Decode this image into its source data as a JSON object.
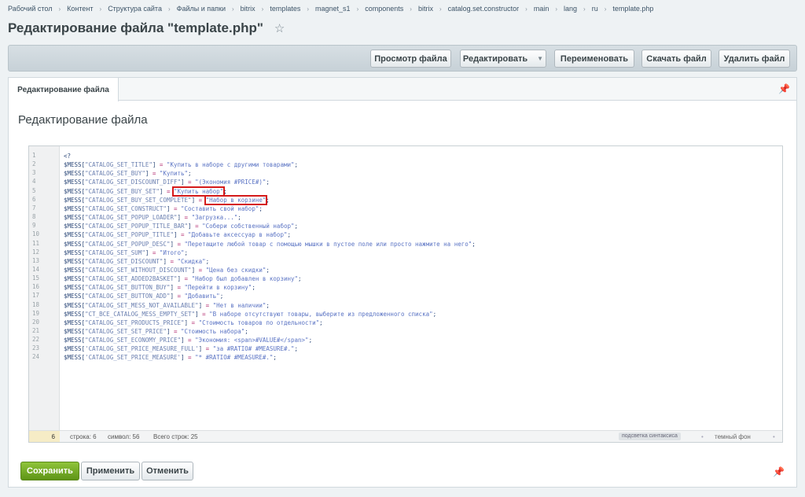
{
  "breadcrumbs": [
    "Рабочий стол",
    "Контент",
    "Структура сайта",
    "Файлы и папки",
    "bitrix",
    "templates",
    "magnet_s1",
    "components",
    "bitrix",
    "catalog.set.constructor",
    "main",
    "lang",
    "ru",
    "template.php"
  ],
  "page": {
    "title": "Редактирование файла \"template.php\"",
    "star_icon": "☆"
  },
  "toolbar": {
    "view_label": "Просмотр файла",
    "edit_label": "Редактировать",
    "rename_label": "Переименовать",
    "download_label": "Скачать файл",
    "delete_label": "Удалить файл"
  },
  "tabs": [
    {
      "label": "Редактирование файла"
    }
  ],
  "section_title": "Редактирование файла",
  "code_lines": [
    "<?",
    "$MESS[\"CATALOG_SET_TITLE\"] = \"Купить в наборе с другими товарами\";",
    "$MESS[\"CATALOG_SET_BUY\"] = \"Купить\";",
    "$MESS[\"CATALOG_SET_DISCOUNT_DIFF\"] = \"(Экономия #PRICE#)\";",
    "$MESS[\"CATALOG_SET_BUY_SET\"] = \"Купить набор\";",
    "$MESS[\"CATALOG_SET_BUY_SET_COMPLETE\"] = \"Набор в корзине\";",
    "$MESS[\"CATALOG_SET_CONSTRUCT\"] = \"Составить свой набор\";",
    "$MESS[\"CATALOG_SET_POPUP_LOADER\"] = \"Загрузка...\";",
    "$MESS[\"CATALOG_SET_POPUP_TITLE_BAR\"] = \"Собери собственный набор\";",
    "$MESS[\"CATALOG_SET_POPUP_TITLE\"] = \"Добавьте аксессуар в набор\";",
    "$MESS[\"CATALOG_SET_POPUP_DESC\"] = \"Перетащите любой товар с помощью мышки в пустое поле или просто нажмите на него\";",
    "$MESS[\"CATALOG_SET_SUM\"] = \"Итого\";",
    "$MESS[\"CATALOG_SET_DISCOUNT\"] = \"Скидка\";",
    "$MESS[\"CATALOG_SET_WITHOUT_DISCOUNT\"] = \"Цена без скидки\";",
    "$MESS[\"CATALOG_SET_ADDED2BASKET\"] = \"Набор был добавлен в корзину\";",
    "$MESS[\"CATALOG_SET_BUTTON_BUY\"] = \"Перейти в корзину\";",
    "$MESS[\"CATALOG_SET_BUTTON_ADD\"] = \"Добавить\";",
    "$MESS[\"CATALOG_SET_MESS_NOT_AVAILABLE\"] = \"Нет в наличии\";",
    "$MESS[\"CT_BCE_CATALOG_MESS_EMPTY_SET\"] = \"В наборе отсутствуют товары, выберите из предложенного списка\";",
    "$MESS[\"CATALOG_SET_PRODUCTS_PRICE\"] = \"Стоимость товаров по отдельности\";",
    "$MESS[\"CATALOG_SET_SET_PRICE\"] = \"Стоимость набора\";",
    "$MESS[\"CATALOG_SET_ECONOMY_PRICE\"] = \"Экономия: <span>#VALUE#</span>\";",
    "$MESS['CATALOG_SET_PRICE_MEASURE_FULL'] = \"за #RATIO# #MEASURE#.\";",
    "$MESS['CATALOG_SET_PRICE_MEASURE'] = \"* #RATIO# #MEASURE#.\";"
  ],
  "highlighted_lines": [
    5,
    6
  ],
  "statusbar": {
    "current_line": "6",
    "line_info": "строка: 6",
    "char_info": "символ: 56",
    "total_info": "Всего строк: 25",
    "syntax_label": "подсветка синтаксиса",
    "dark_label": "темный фон"
  },
  "footer": {
    "save_label": "Сохранить",
    "apply_label": "Применить",
    "cancel_label": "Отменить"
  },
  "colors": {
    "primary_button": "#6ea51f",
    "highlight_box": "#d51a1a"
  }
}
